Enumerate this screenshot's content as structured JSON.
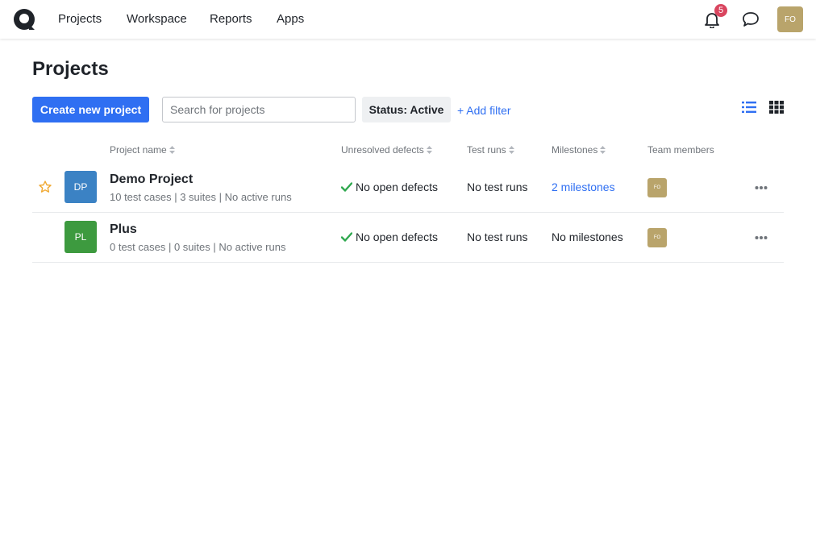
{
  "nav": {
    "items": [
      "Projects",
      "Workspace",
      "Reports",
      "Apps"
    ],
    "notifications_count": "5",
    "user_initials": "FO"
  },
  "page": {
    "title": "Projects",
    "create_button": "Create new project",
    "search_placeholder": "Search for projects",
    "status_filter": "Status: Active",
    "add_filter": "+ Add filter"
  },
  "table": {
    "columns": [
      "Project name",
      "Unresolved defects",
      "Test runs",
      "Milestones",
      "Team members"
    ],
    "rows": [
      {
        "initials": "DP",
        "avatar_color": "#3b82c4",
        "name": "Demo Project",
        "meta": "10 test cases | 3 suites | No active runs",
        "defects": "No open defects",
        "test_runs": "No test runs",
        "milestones": "2 milestones",
        "member": "FO",
        "starred": true
      },
      {
        "initials": "PL",
        "avatar_color": "#3d9a3f",
        "name": "Plus",
        "meta": "0 test cases | 0 suites | No active runs",
        "defects": "No open defects",
        "test_runs": "No test runs",
        "milestones": "No milestones",
        "member": "FO",
        "starred": false
      }
    ]
  },
  "colors": {
    "primary": "#2f6ff2",
    "success": "#2fa84f",
    "star": "#f0a830",
    "badge": "#d9455f",
    "user_avatar": "#b9a46b"
  }
}
